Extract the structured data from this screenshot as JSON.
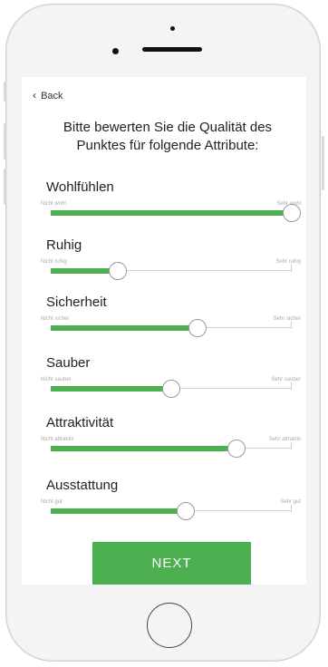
{
  "nav": {
    "back_label": "Back",
    "back_chevron": "‹"
  },
  "title_line1": "Bitte bewerten Sie die Qualität des",
  "title_line2": "Punktes für folgende Attribute:",
  "attributes": [
    {
      "label": "Wohlfühlen",
      "min_label": "Nicht wohl",
      "max_label": "Sehr wohl",
      "value": 1.0
    },
    {
      "label": "Ruhig",
      "min_label": "Nicht ruhig",
      "max_label": "Sehr ruhig",
      "value": 0.28
    },
    {
      "label": "Sicherheit",
      "min_label": "Nicht sicher",
      "max_label": "Sehr sicher",
      "value": 0.61
    },
    {
      "label": "Sauber",
      "min_label": "Nicht sauber",
      "max_label": "Sehr sauber",
      "value": 0.5
    },
    {
      "label": "Attraktivität",
      "min_label": "Nicht attraktiv",
      "max_label": "Sehr attraktiv",
      "value": 0.77
    },
    {
      "label": "Ausstattung",
      "min_label": "Nicht gut",
      "max_label": "Sehr gut",
      "value": 0.56
    }
  ],
  "next_label": "NEXT",
  "colors": {
    "accent": "#4caf50"
  }
}
